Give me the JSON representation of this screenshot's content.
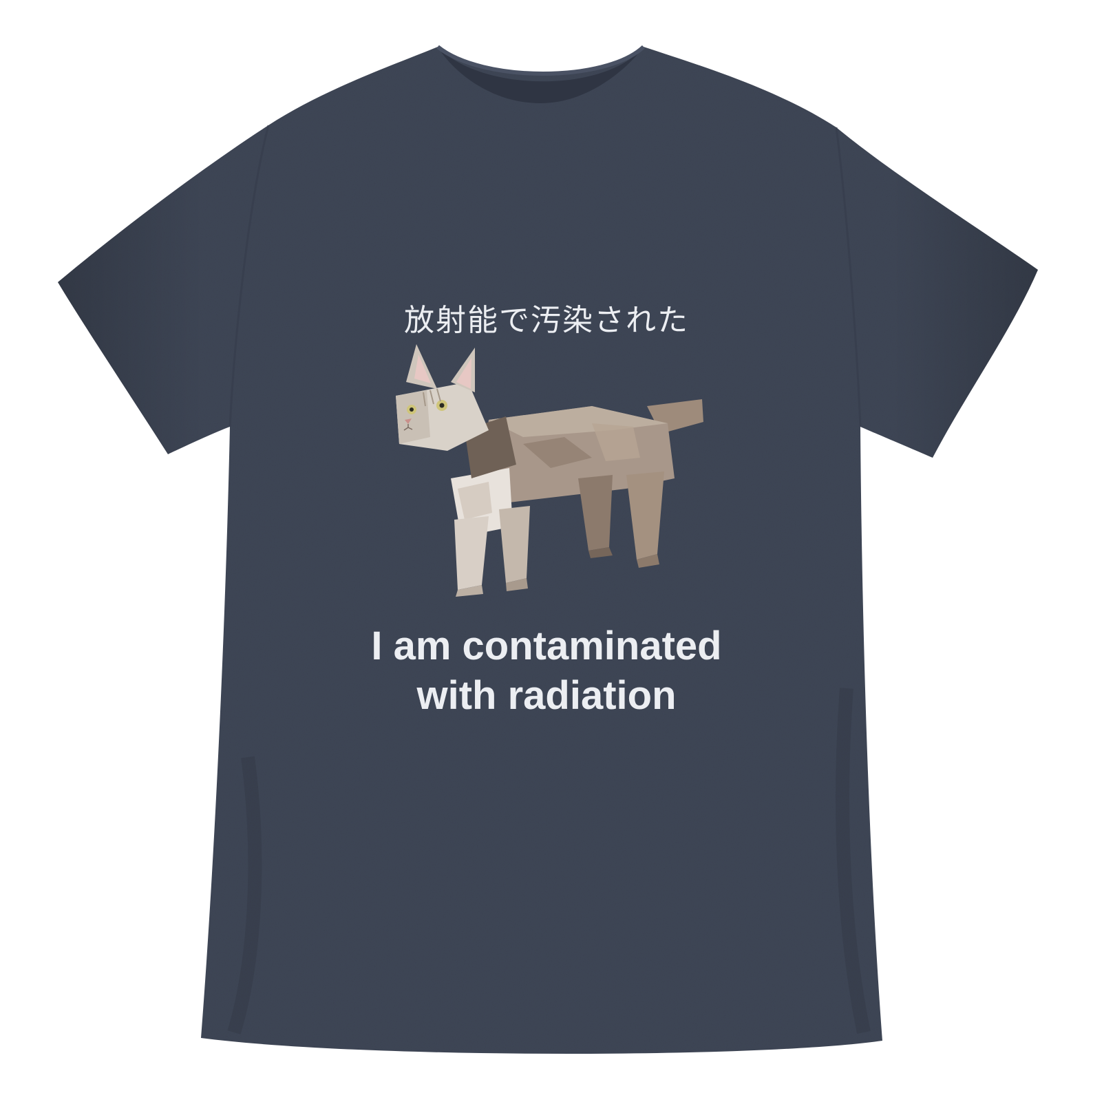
{
  "product": {
    "garment_color": "#3f4656",
    "print_color": "#eceef2",
    "graphic": "pixelated-3d-cat-icon"
  },
  "print": {
    "japanese_text": "放射能で汚染された",
    "english_line_1": "I am contaminated",
    "english_line_2": "with radiation"
  }
}
